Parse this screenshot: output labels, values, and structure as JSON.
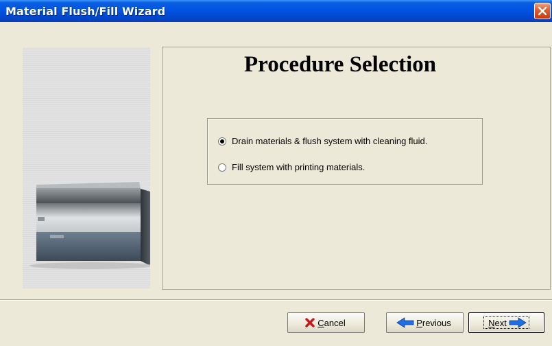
{
  "window": {
    "title": "Material Flush/Fill Wizard"
  },
  "page": {
    "heading": "Procedure Selection"
  },
  "options": [
    {
      "label": "Drain materials & flush system with cleaning fluid.",
      "selected": true
    },
    {
      "label": "Fill system with printing materials.",
      "selected": false
    }
  ],
  "buttons": {
    "cancel": {
      "mnemonic": "C",
      "rest": "ancel"
    },
    "previous": {
      "mnemonic": "P",
      "rest": "revious"
    },
    "next": {
      "mnemonic": "N",
      "rest": "ext"
    }
  },
  "icons": {
    "close": "close-icon",
    "cancel": "red-x-icon",
    "previous": "blue-left-arrow-icon",
    "next": "blue-right-arrow-icon",
    "device": "printer-device-icon"
  },
  "colors": {
    "titlebar": "#0054e3",
    "background": "#ece9d8",
    "close_button": "#e25a2c",
    "arrow_blue": "#1f6fe0",
    "cancel_red": "#c8161d"
  }
}
